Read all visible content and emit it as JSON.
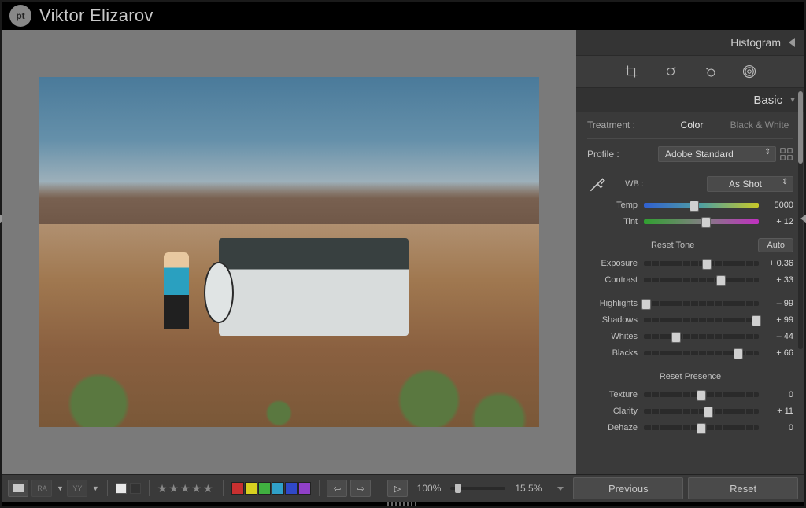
{
  "topbar": {
    "logo_text": "pt",
    "user_name": "Viktor Elizarov"
  },
  "panels": {
    "histogram": {
      "title": "Histogram"
    },
    "basic": {
      "title": "Basic",
      "treatment": {
        "label": "Treatment :",
        "color": "Color",
        "bw": "Black & White"
      },
      "profile": {
        "label": "Profile :",
        "value": "Adobe Standard"
      },
      "wb": {
        "label": "WB :",
        "value": "As Shot"
      },
      "sliders": {
        "temp": {
          "label": "Temp",
          "value": "5000",
          "pos": 44
        },
        "tint": {
          "label": "Tint",
          "value": "+ 12",
          "pos": 54
        },
        "exposure": {
          "label": "Exposure",
          "value": "+ 0.36",
          "pos": 55
        },
        "contrast": {
          "label": "Contrast",
          "value": "+ 33",
          "pos": 67
        },
        "highlights": {
          "label": "Highlights",
          "value": "– 99",
          "pos": 2
        },
        "shadows": {
          "label": "Shadows",
          "value": "+ 99",
          "pos": 98
        },
        "whites": {
          "label": "Whites",
          "value": "– 44",
          "pos": 28
        },
        "blacks": {
          "label": "Blacks",
          "value": "+ 66",
          "pos": 82
        },
        "texture": {
          "label": "Texture",
          "value": "0",
          "pos": 50
        },
        "clarity": {
          "label": "Clarity",
          "value": "+ 11",
          "pos": 56
        },
        "dehaze": {
          "label": "Dehaze",
          "value": "0",
          "pos": 50
        }
      },
      "tone": {
        "label": "Reset Tone",
        "auto": "Auto"
      },
      "presence": {
        "label": "Reset Presence"
      }
    }
  },
  "footer": {
    "zoom_fit": "100%",
    "zoom_val": "15.5%",
    "previous": "Previous",
    "reset": "Reset",
    "swatches": [
      "#c83030",
      "#d8d020",
      "#40b040",
      "#30a0c8",
      "#3048c8",
      "#9040c8"
    ]
  }
}
